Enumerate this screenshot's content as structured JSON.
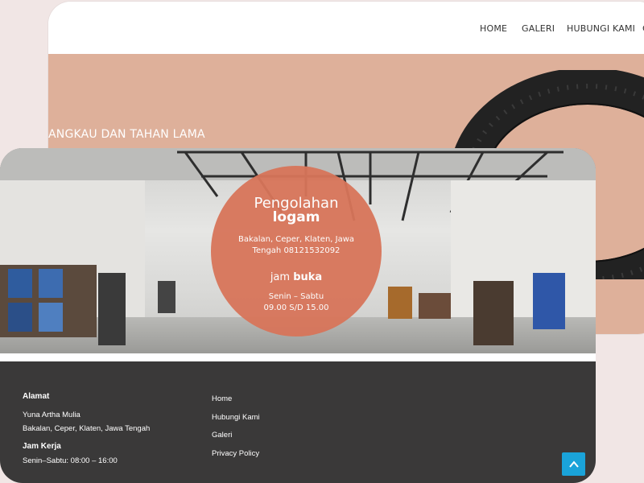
{
  "nav": {
    "items": [
      "HOME",
      "GALERI",
      "HUBUNGI KAMI"
    ]
  },
  "hero": {
    "tagline": "ANGKAU DAN TAHAN LAMA"
  },
  "circle": {
    "title_light": "Pengolahan",
    "title_bold": "logam",
    "address": "Bakalan, Ceper, Klaten, Jawa Tengah 08121532092",
    "hours_prefix": "jam",
    "hours_bold": "buka",
    "days": "Senin – Sabtu",
    "hours": "09.00 S/D 15.00"
  },
  "footer": {
    "address_heading": "Alamat",
    "company": "Yuna Artha Mulia",
    "address": "Bakalan, Ceper, Klaten, Jawa Tengah",
    "hours_heading": "Jam Kerja",
    "hours": "Senin–Sabtu: 08:00 – 16:00",
    "links": [
      "Home",
      "Hubungi Kami",
      "Galeri",
      "Privacy Policy"
    ]
  },
  "colors": {
    "background": "#f1e6e5",
    "hero": "#deb09a",
    "circle": "#d8755a",
    "footer": "#3a3939",
    "scroll_button": "#1aa3d9"
  },
  "icons": {
    "scroll_top": "chevron-up-icon"
  }
}
